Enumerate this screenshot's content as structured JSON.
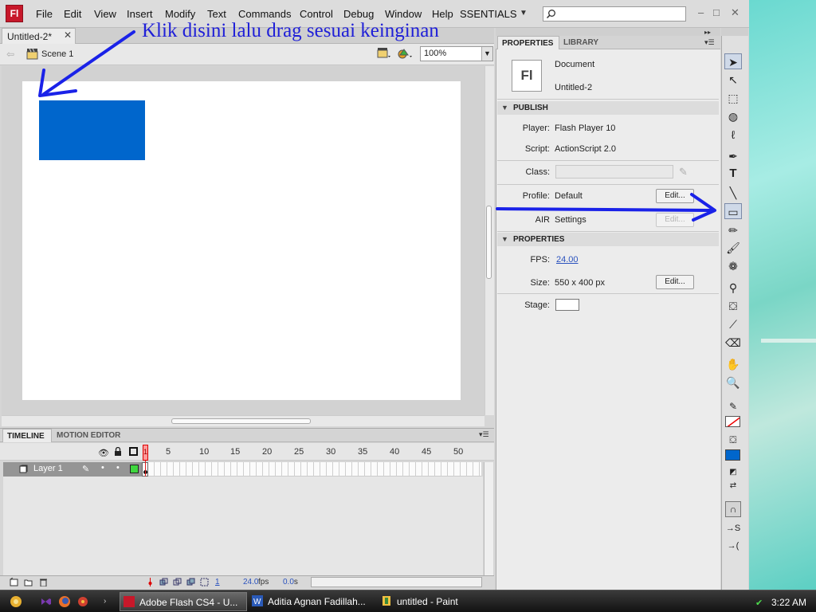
{
  "app": {
    "logo": "Fl",
    "menu": [
      "File",
      "Edit",
      "View",
      "Insert",
      "Modify",
      "Text",
      "Commands",
      "Control",
      "Debug",
      "Window",
      "Help"
    ],
    "workspace": "SSENTIALS",
    "window_controls": [
      "–",
      "□",
      "✕"
    ]
  },
  "document": {
    "tab_label": "Untitled-2*",
    "close_glyph": "✕",
    "scene": "Scene 1",
    "zoom": "100%"
  },
  "annotation": {
    "text": "Klik disini lalu drag sesuai keinginan",
    "color": "#1f1fd8"
  },
  "stage_objects": [
    {
      "shape": "rectangle",
      "fill": "#0066cc"
    }
  ],
  "timeline": {
    "tabs": [
      "TIMELINE",
      "MOTION EDITOR"
    ],
    "frame_numbers": [
      "1",
      "5",
      "10",
      "15",
      "20",
      "25",
      "30",
      "35",
      "40",
      "45",
      "50"
    ],
    "layer_name": "Layer 1",
    "current_frame": "1",
    "frame_rate": "24.0",
    "fps_unit": "fps",
    "elapsed": "0.0",
    "elapsed_unit": "s"
  },
  "properties": {
    "tabs": [
      "PROPERTIES",
      "LIBRARY"
    ],
    "doc_icon": "Fl",
    "doc_type": "Document",
    "doc_name": "Untitled-2",
    "publish_header": "PUBLISH",
    "player_label": "Player:",
    "player_value": "Flash Player 10",
    "script_label": "Script:",
    "script_value": "ActionScript 2.0",
    "class_label": "Class:",
    "profile_label": "Profile:",
    "profile_value": "Default",
    "edit_label": "Edit...",
    "air_label": "AIR",
    "air_value": "Settings",
    "properties_header": "PROPERTIES",
    "fps_label": "FPS:",
    "fps_value": "24.00",
    "size_label": "Size:",
    "size_value": "550 x 400 px",
    "stage_label": "Stage:"
  },
  "tools": {
    "stroke_color": "#ffffff",
    "fill_color": "#0066cc"
  },
  "taskbar": {
    "tasks": [
      "Adobe Flash CS4 - U...",
      "Aditia Agnan Fadillah...",
      "untitled - Paint"
    ],
    "clock": "3:22 AM"
  }
}
